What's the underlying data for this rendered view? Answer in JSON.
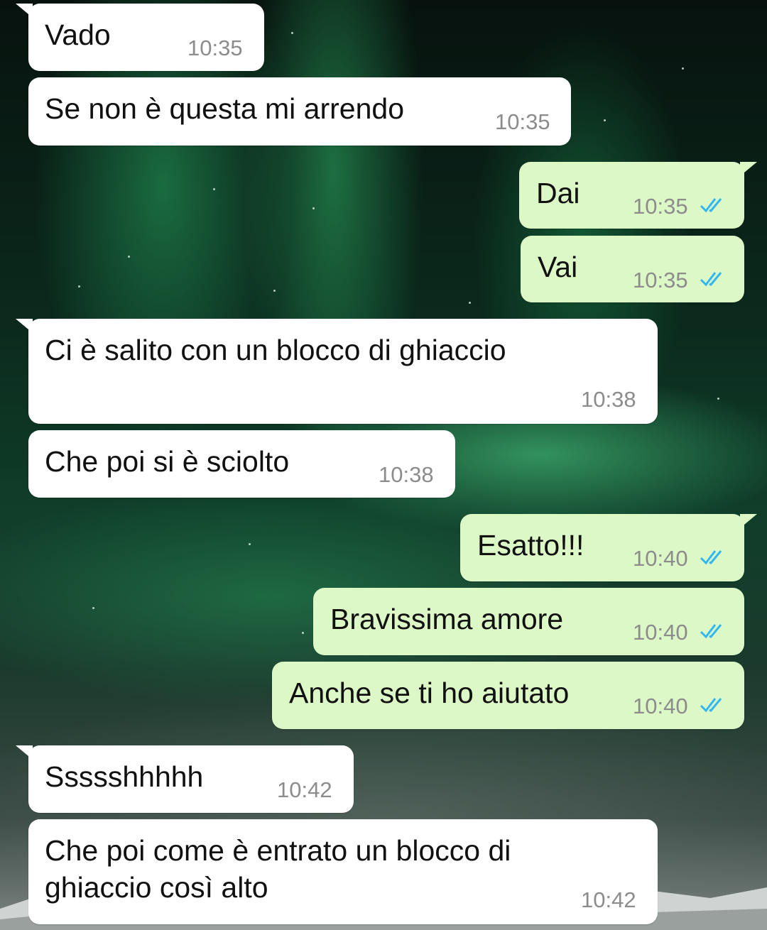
{
  "messages": [
    {
      "direction": "incoming",
      "text": "Vado",
      "time": "10:35"
    },
    {
      "direction": "incoming",
      "text": "Se non è questa mi arrendo",
      "time": "10:35"
    },
    {
      "direction": "outgoing",
      "text": "Dai",
      "time": "10:35",
      "status": "read-double-check-icon"
    },
    {
      "direction": "outgoing",
      "text": "Vai",
      "time": "10:35",
      "status": "read-double-check-icon"
    },
    {
      "direction": "incoming",
      "text": "Ci è salito con un blocco di ghiaccio",
      "time": "10:38"
    },
    {
      "direction": "incoming",
      "text": "Che poi si è sciolto",
      "time": "10:38"
    },
    {
      "direction": "outgoing",
      "text": "Esatto!!!",
      "time": "10:40",
      "status": "read-double-check-icon"
    },
    {
      "direction": "outgoing",
      "text": "Bravissima amore",
      "time": "10:40",
      "status": "read-double-check-icon"
    },
    {
      "direction": "outgoing",
      "text": "Anche se ti ho aiutato",
      "time": "10:40",
      "status": "read-double-check-icon"
    },
    {
      "direction": "incoming",
      "text": "Ssssshhhhh",
      "time": "10:42"
    },
    {
      "direction": "incoming",
      "text": "Che poi come è entrato un blocco di\nghiaccio così alto",
      "time": "10:42"
    }
  ],
  "colors": {
    "incoming_bubble": "#ffffff",
    "outgoing_bubble": "#dcf8c6",
    "read_ticks": "#34b7f1",
    "timestamp": "#8c8c8c"
  },
  "wallpaper": "aurora-borealis-night-sky"
}
